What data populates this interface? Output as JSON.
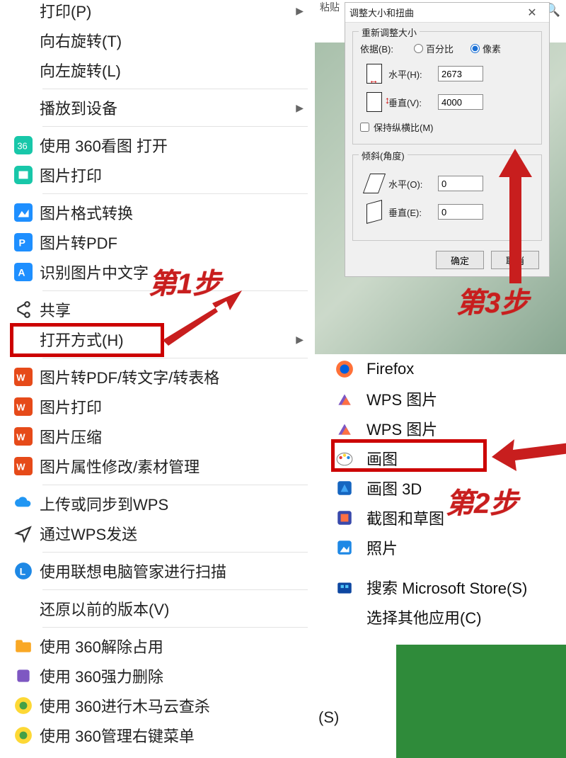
{
  "paste_label": "粘贴",
  "search_icon": "🔍",
  "ctx": {
    "print_trunc": "打印(P)",
    "rotate_r": "向右旋转(T)",
    "rotate_l": "向左旋转(L)",
    "cast": "播放到设备",
    "open_360view": "使用 360看图 打开",
    "img_print": "图片打印",
    "img_convert": "图片格式转换",
    "img_pdf": "图片转PDF",
    "img_ocr": "识别图片中文字",
    "share": "共享",
    "open_with": "打开方式(H)",
    "wps_convert": "图片转PDF/转文字/转表格",
    "wps_print": "图片打印",
    "wps_compress": "图片压缩",
    "wps_prop": "图片属性修改/素材管理",
    "wps_upload": "上传或同步到WPS",
    "wps_send": "通过WPS发送",
    "lenovo_scan": "使用联想电脑管家进行扫描",
    "restore": "还原以前的版本(V)",
    "unlock360": "使用 360解除占用",
    "forcedel360": "使用 360强力删除",
    "trojan360": "使用 360进行木马云查杀",
    "rightmenu360": "使用 360管理右键菜单"
  },
  "apps": {
    "firefox": "Firefox",
    "wps_pic1": "WPS 图片",
    "wps_pic2": "WPS 图片",
    "paint": "画图",
    "paint3d": "画图 3D",
    "snip": "截图和草图",
    "photos": "照片",
    "store": "搜索 Microsoft Store(S)",
    "choose": "选择其他应用(C)"
  },
  "dlg": {
    "title": "调整大小和扭曲",
    "g1_legend": "重新调整大小",
    "by_label": "依据(B):",
    "opt_percent": "百分比",
    "opt_pixel": "像素",
    "h_label": "水平(H):",
    "h_value": "2673",
    "v_label": "垂直(V):",
    "v_value": "4000",
    "keep_ratio": "保持纵横比(M)",
    "g2_legend": "倾斜(角度)",
    "skew_h_label": "水平(O):",
    "skew_h_value": "0",
    "skew_v_label": "垂直(E):",
    "skew_v_value": "0",
    "ok": "确定",
    "cancel": "取消"
  },
  "ann": {
    "step1": "第1步",
    "step2": "第2步",
    "step3": "第3步"
  },
  "trunc_s": "(S)"
}
